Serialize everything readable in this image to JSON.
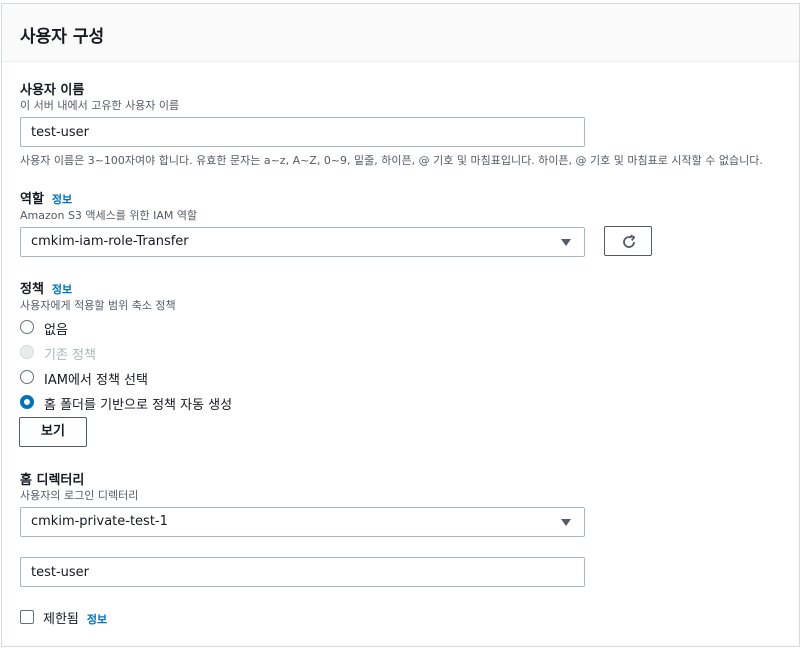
{
  "panel": {
    "title": "사용자 구성"
  },
  "username": {
    "label": "사용자 이름",
    "description": "이 서버 내에서 고유한 사용자 이름",
    "value": "test-user",
    "constraint": "사용자 이름은 3~100자여야 합니다. 유효한 문자는 a~z, A~Z, 0~9, 밑줄, 하이픈, @ 기호 및 마침표입니다. 하이픈, @ 기호 및 마침표로 시작할 수 없습니다."
  },
  "role": {
    "label": "역할",
    "info": "정보",
    "description": "Amazon S3 액세스를 위한 IAM 역할",
    "selected": "cmkim-iam-role-Transfer",
    "refresh_icon": "refresh-icon"
  },
  "policy": {
    "label": "정책",
    "info": "정보",
    "description": "사용자에게 적용할 범위 축소 정책",
    "options": [
      {
        "label": "없음",
        "state": "unchecked"
      },
      {
        "label": "기존 정책",
        "state": "disabled"
      },
      {
        "label": "IAM에서 정책 선택",
        "state": "unchecked"
      },
      {
        "label": "홈 폴더를 기반으로 정책 자동 생성",
        "state": "checked"
      }
    ],
    "view_button": "보기"
  },
  "home_directory": {
    "label": "홈 디렉터리",
    "description": "사용자의 로그인 디렉터리",
    "bucket": "cmkim-private-test-1",
    "path": "test-user"
  },
  "restricted": {
    "label": "제한됨",
    "info": "정보",
    "checked": false
  },
  "colors": {
    "link": "#0073bb",
    "radio_checked": "#0073bb",
    "text": "#16191f",
    "muted": "#545b64"
  }
}
